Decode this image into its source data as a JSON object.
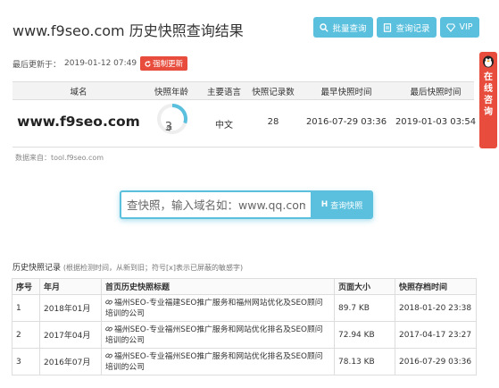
{
  "header": {
    "title": "www.f9seo.com 历史快照查询结果",
    "buttons": {
      "batch": "批量查询",
      "records": "查询记录",
      "vip": "VIP"
    }
  },
  "update": {
    "label": "最后更新于：",
    "time": "2019-01-12 07:49",
    "force_label": "强制更新"
  },
  "summary": {
    "headers": {
      "domain": "域名",
      "age": "快照年龄",
      "lang": "主要语言",
      "count": "快照记录数",
      "earliest": "最早快照时间",
      "latest": "最后快照时间"
    },
    "row": {
      "domain": "www.f9seo.com",
      "age_value": "3",
      "age_unit": "年",
      "age_years": 3,
      "lang": "中文",
      "count": "28",
      "earliest": "2016-07-29 03:36",
      "latest": "2019-01-03 03:54"
    }
  },
  "source": "数据来自：tool.f9seo.com",
  "search": {
    "placeholder": "查快照，输入域名如：www.qq.com",
    "button_icon_letter": "H",
    "button_label": "查询快照"
  },
  "history": {
    "title": "历史快照记录",
    "note": "(根据检测时间，从新到旧；符号[x]表示已屏蔽的敏感字)",
    "columns": {
      "no": "序号",
      "month": "年月",
      "page_title": "首页历史快照标题",
      "size": "页面大小",
      "stored": "快照存档时间"
    },
    "rows": [
      {
        "no": "1",
        "month": "2018年01月",
        "title": "福州SEO-专业福建SEO推广服务和福州网站优化及SEO顾问培训的公司",
        "size": "89.7 KB",
        "stored": "2018-01-20 23:38"
      },
      {
        "no": "2",
        "month": "2017年04月",
        "title": "福州SEO-专业福州SEO推广服务和网站优化排名及SEO顾问培训的公司",
        "size": "72.94 KB",
        "stored": "2017-04-17 23:27"
      },
      {
        "no": "3",
        "month": "2016年07月",
        "title": "福州SEO-专业福州SEO推广服务和网站优化排名及SEO顾问培训的公司",
        "size": "78.13 KB",
        "stored": "2016-07-29 03:36"
      }
    ]
  },
  "side": {
    "text": "在线咨询"
  },
  "colors": {
    "accent": "#5bc0de",
    "danger": "#e74c3c"
  }
}
